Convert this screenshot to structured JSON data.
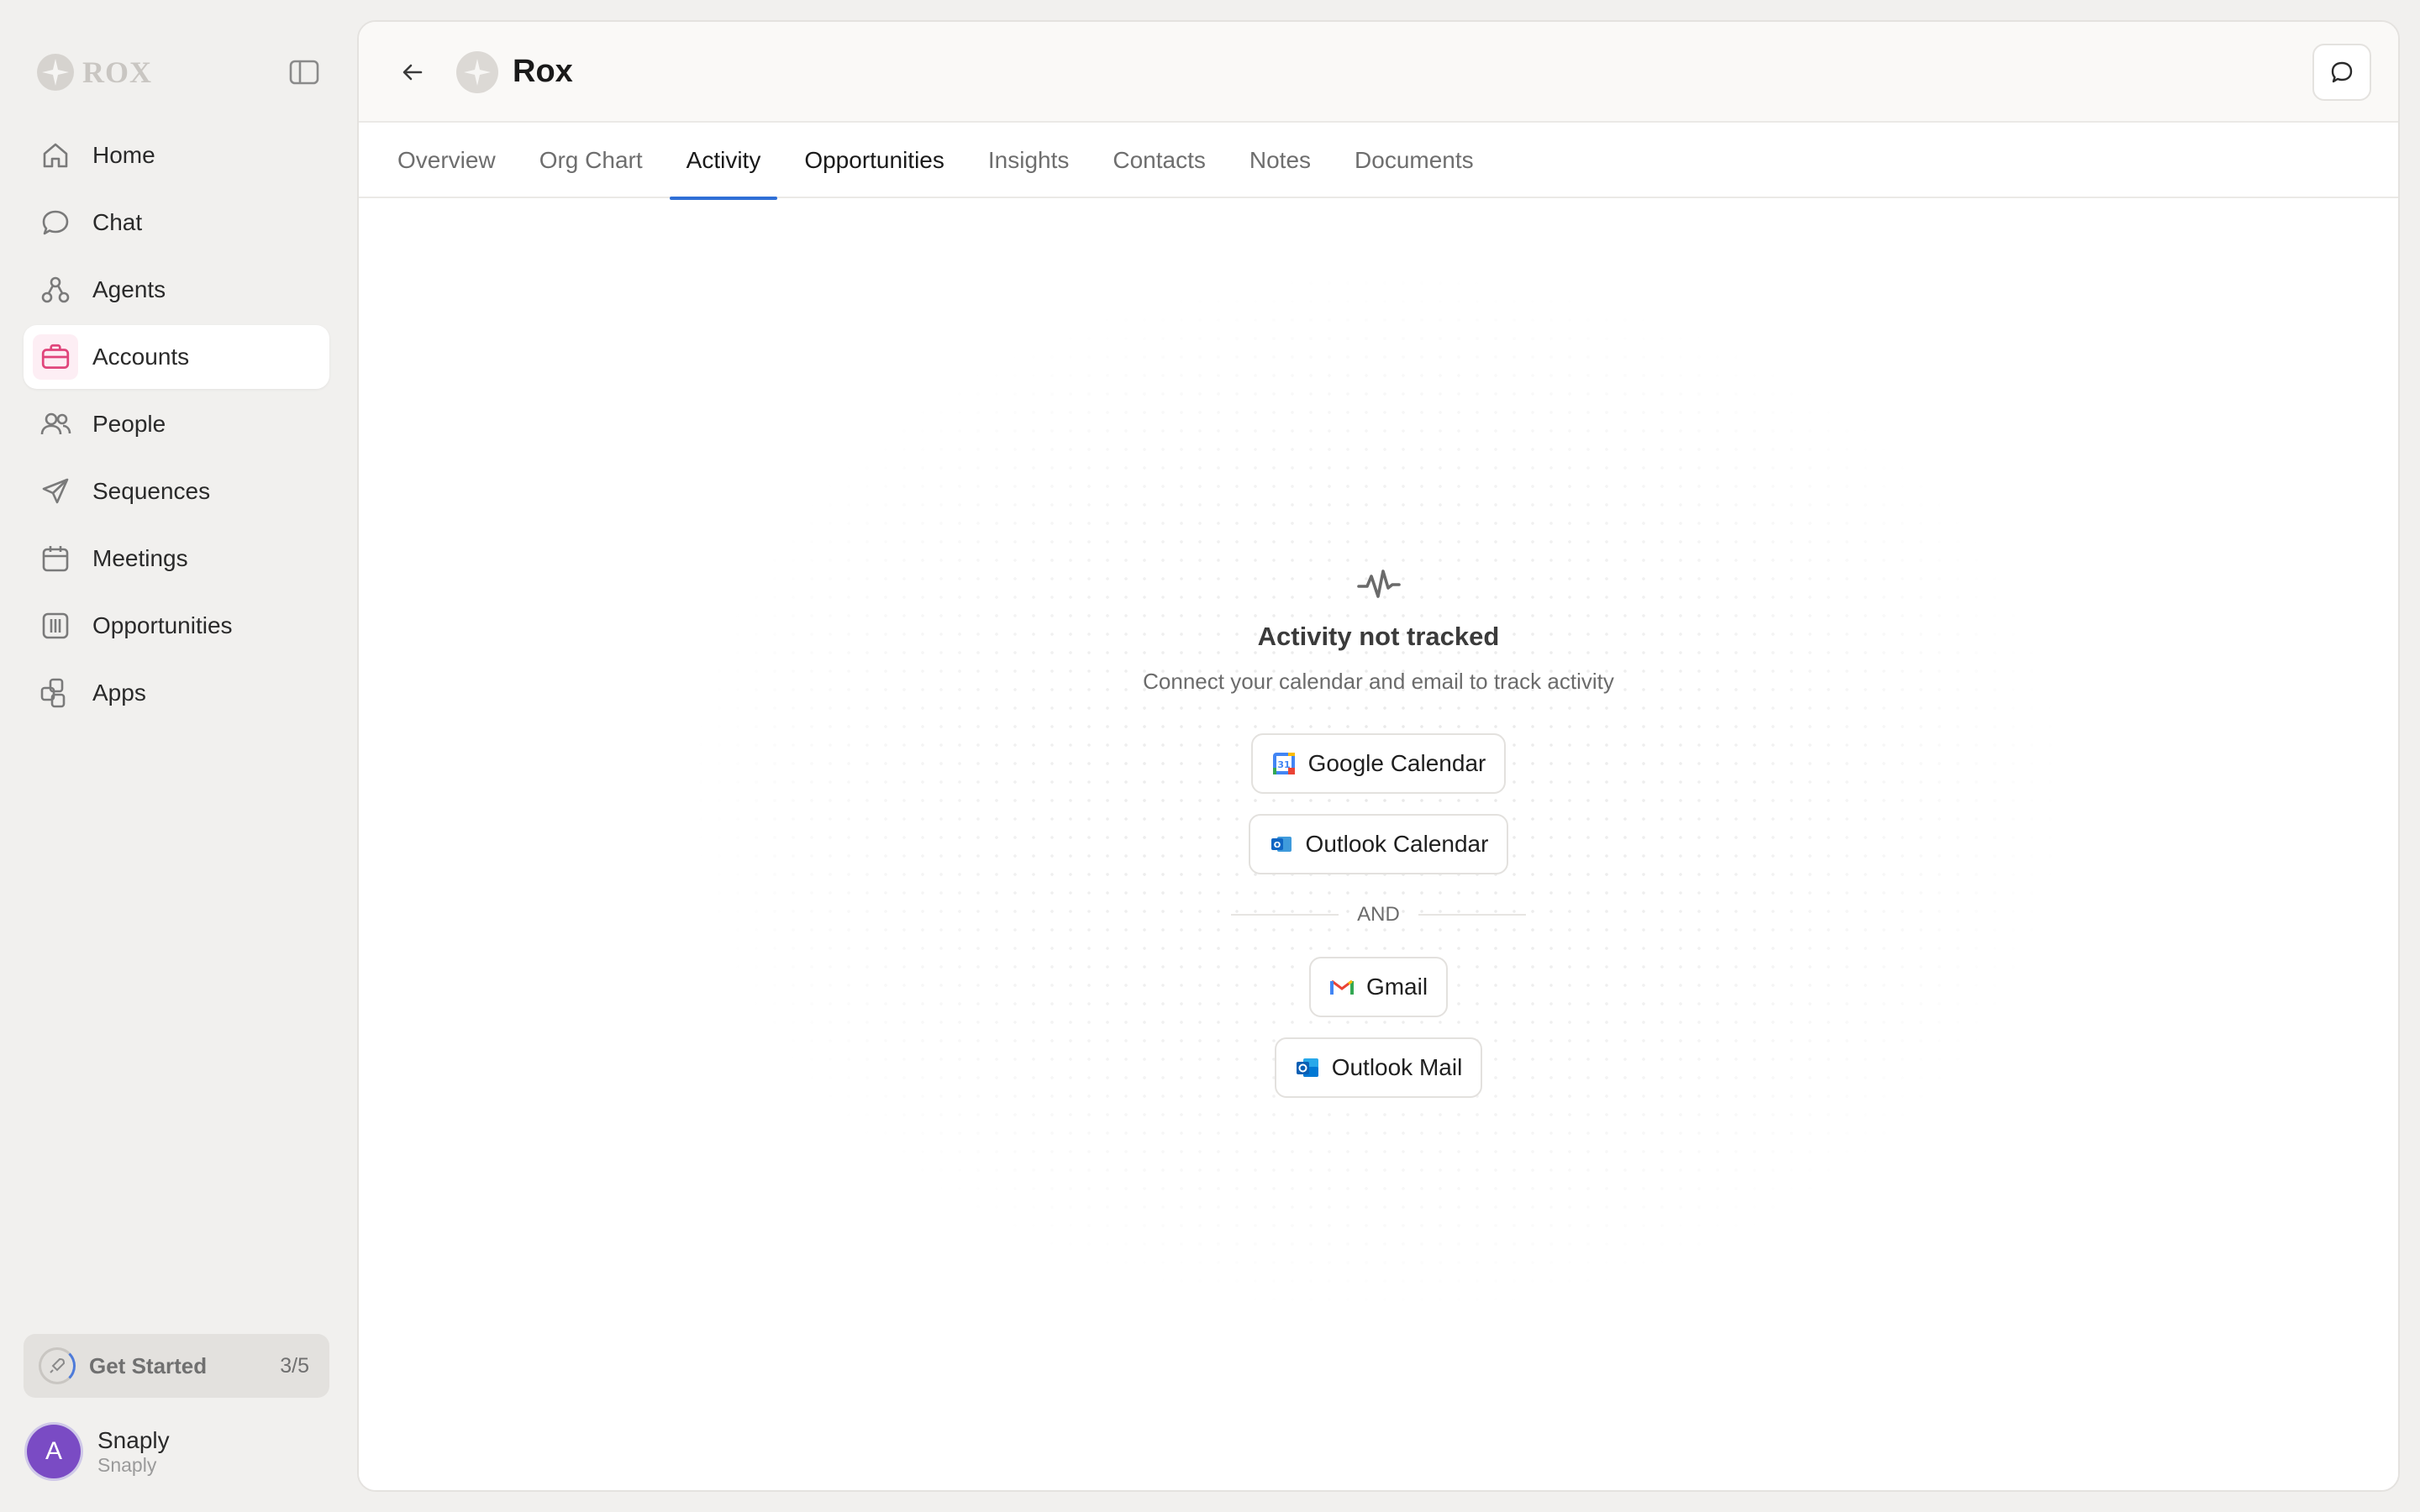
{
  "brand": {
    "logo_text": "ROX"
  },
  "sidebar": {
    "items": [
      {
        "label": "Home",
        "icon": "home-icon"
      },
      {
        "label": "Chat",
        "icon": "chat-bubble-icon"
      },
      {
        "label": "Agents",
        "icon": "agents-icon"
      },
      {
        "label": "Accounts",
        "icon": "briefcase-icon",
        "active": true
      },
      {
        "label": "People",
        "icon": "people-icon"
      },
      {
        "label": "Sequences",
        "icon": "send-icon"
      },
      {
        "label": "Meetings",
        "icon": "calendar-icon"
      },
      {
        "label": "Opportunities",
        "icon": "columns-icon"
      },
      {
        "label": "Apps",
        "icon": "apps-icon"
      }
    ],
    "get_started": {
      "label": "Get Started",
      "count": "3/5"
    },
    "user": {
      "avatar_letter": "A",
      "name": "Snaply",
      "workspace": "Snaply"
    }
  },
  "header": {
    "company_name": "Rox"
  },
  "tabs": [
    {
      "label": "Overview"
    },
    {
      "label": "Org Chart"
    },
    {
      "label": "Activity",
      "active": true
    },
    {
      "label": "Opportunities"
    },
    {
      "label": "Insights"
    },
    {
      "label": "Contacts"
    },
    {
      "label": "Notes"
    },
    {
      "label": "Documents"
    }
  ],
  "empty_state": {
    "title": "Activity not tracked",
    "subtitle": "Connect your calendar and email to track activity",
    "calendar_buttons": [
      "Google Calendar",
      "Outlook Calendar"
    ],
    "divider": "AND",
    "email_buttons": [
      "Gmail",
      "Outlook Mail"
    ]
  },
  "colors": {
    "accent": "#2f6fd6",
    "active_icon": "#e0457b",
    "avatar": "#7a4bc4"
  }
}
